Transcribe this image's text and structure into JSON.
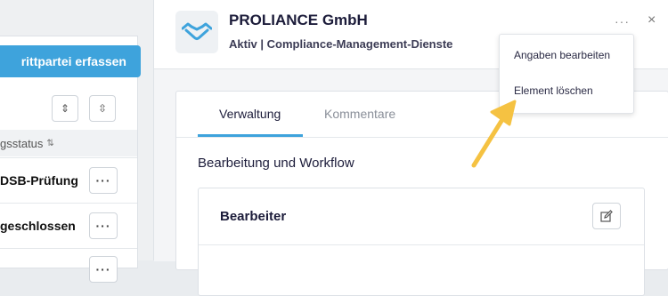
{
  "background_list": {
    "add_button_label": "rittpartei erfassen",
    "expand_icon": "expand-vertical-icon",
    "collapse_icon": "collapse-vertical-icon",
    "column_header": "gsstatus",
    "rows": [
      {
        "label": "DSB-Prüfung",
        "action_label": "···"
      },
      {
        "label": "geschlossen",
        "action_label": "···"
      },
      {
        "label": "",
        "action_label": "···"
      }
    ]
  },
  "detail": {
    "title": "PROLIANCE GmbH",
    "subtitle": "Aktiv | Compliance-Management-Dienste",
    "more_label": "···",
    "close_label": "×",
    "tabs": [
      {
        "label": "Verwaltung",
        "active": true
      },
      {
        "label": "Kommentare",
        "active": false
      }
    ],
    "section_title": "Bearbeitung und Workflow",
    "assignee_card_title": "Bearbeiter"
  },
  "menu": {
    "items": [
      {
        "label": "Angaben bearbeiten"
      },
      {
        "label": "Element löschen"
      }
    ]
  },
  "colors": {
    "accent": "#3ea3dc",
    "arrow": "#f5c242"
  }
}
